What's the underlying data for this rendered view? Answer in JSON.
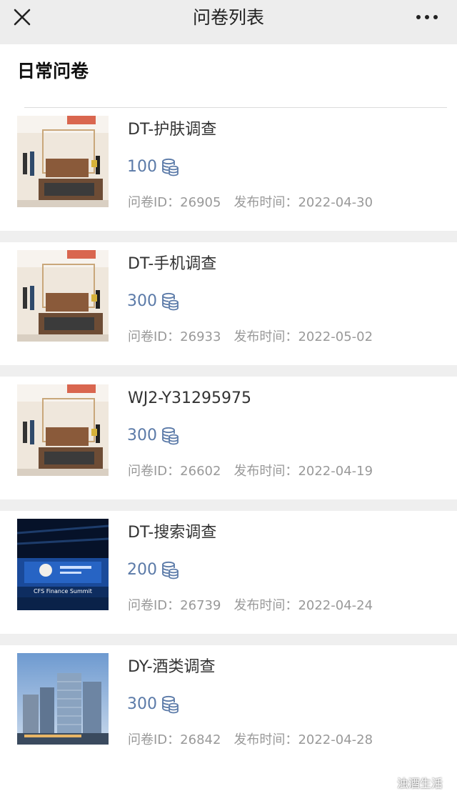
{
  "nav": {
    "title": "问卷列表"
  },
  "section": {
    "title": "日常问卷"
  },
  "labels": {
    "id_prefix": "问卷ID：",
    "time_prefix": "发布时间："
  },
  "items": [
    {
      "title": "DT-护肤调查",
      "points": "100",
      "id": "26905",
      "date": "2022-04-30",
      "thumb": "room"
    },
    {
      "title": "DT-手机调查",
      "points": "300",
      "id": "26933",
      "date": "2022-05-02",
      "thumb": "room"
    },
    {
      "title": "WJ2-Y31295975",
      "points": "300",
      "id": "26602",
      "date": "2022-04-19",
      "thumb": "room"
    },
    {
      "title": "DT-搜索调查",
      "points": "200",
      "id": "26739",
      "date": "2022-04-24",
      "thumb": "summit"
    },
    {
      "title": "DY-酒类调查",
      "points": "300",
      "id": "26842",
      "date": "2022-04-28",
      "thumb": "city"
    }
  ],
  "thumbs": {
    "summit": {
      "banner_text": "CFS Finance Summit"
    }
  },
  "watermark": {
    "text": "浊酒生活"
  },
  "colors": {
    "points": "#5b7aa8",
    "meta": "#999999",
    "navbar": "#ededed",
    "separator": "#efefef"
  }
}
